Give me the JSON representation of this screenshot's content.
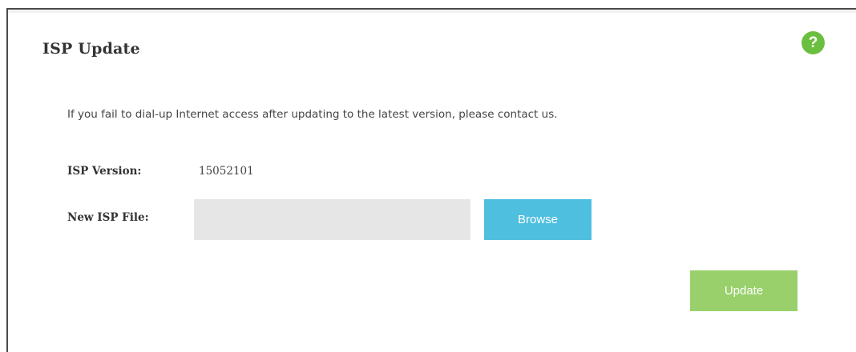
{
  "panel": {
    "title": "ISP Update",
    "help_icon": {
      "glyph": "?",
      "icon": "help-icon",
      "color": "#6bbf3f"
    }
  },
  "notice": "If you fail to dial-up Internet access after updating to the latest version, please contact us.",
  "isp_version": {
    "label": "ISP Version:",
    "value": "15052101"
  },
  "new_isp_file": {
    "label": "New ISP File:",
    "value": "",
    "placeholder": ""
  },
  "buttons": {
    "browse_label": "Browse",
    "update_label": "Update"
  },
  "colors": {
    "browse_button": "#4fbfe0",
    "update_button": "#99d06b",
    "input_background": "#e6e6e6"
  }
}
